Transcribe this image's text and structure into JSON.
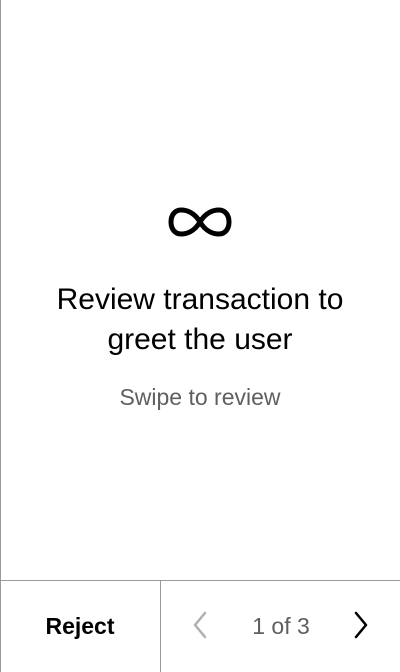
{
  "screen": {
    "logo_icon": "infinity-logo-icon",
    "title": "Review transaction to greet the user",
    "subtitle": "Swipe to review"
  },
  "footer": {
    "reject_label": "Reject",
    "pagination": {
      "current": 1,
      "total": 3,
      "label": "1 of 3",
      "prev_icon": "chevron-left-icon",
      "next_icon": "chevron-right-icon",
      "prev_enabled": false,
      "next_enabled": true
    }
  },
  "colors": {
    "background": "#ffffff",
    "text_primary": "#000000",
    "text_secondary": "#5f5f5f",
    "border": "#9a9a9a",
    "disabled_icon": "#b0b0b0"
  }
}
